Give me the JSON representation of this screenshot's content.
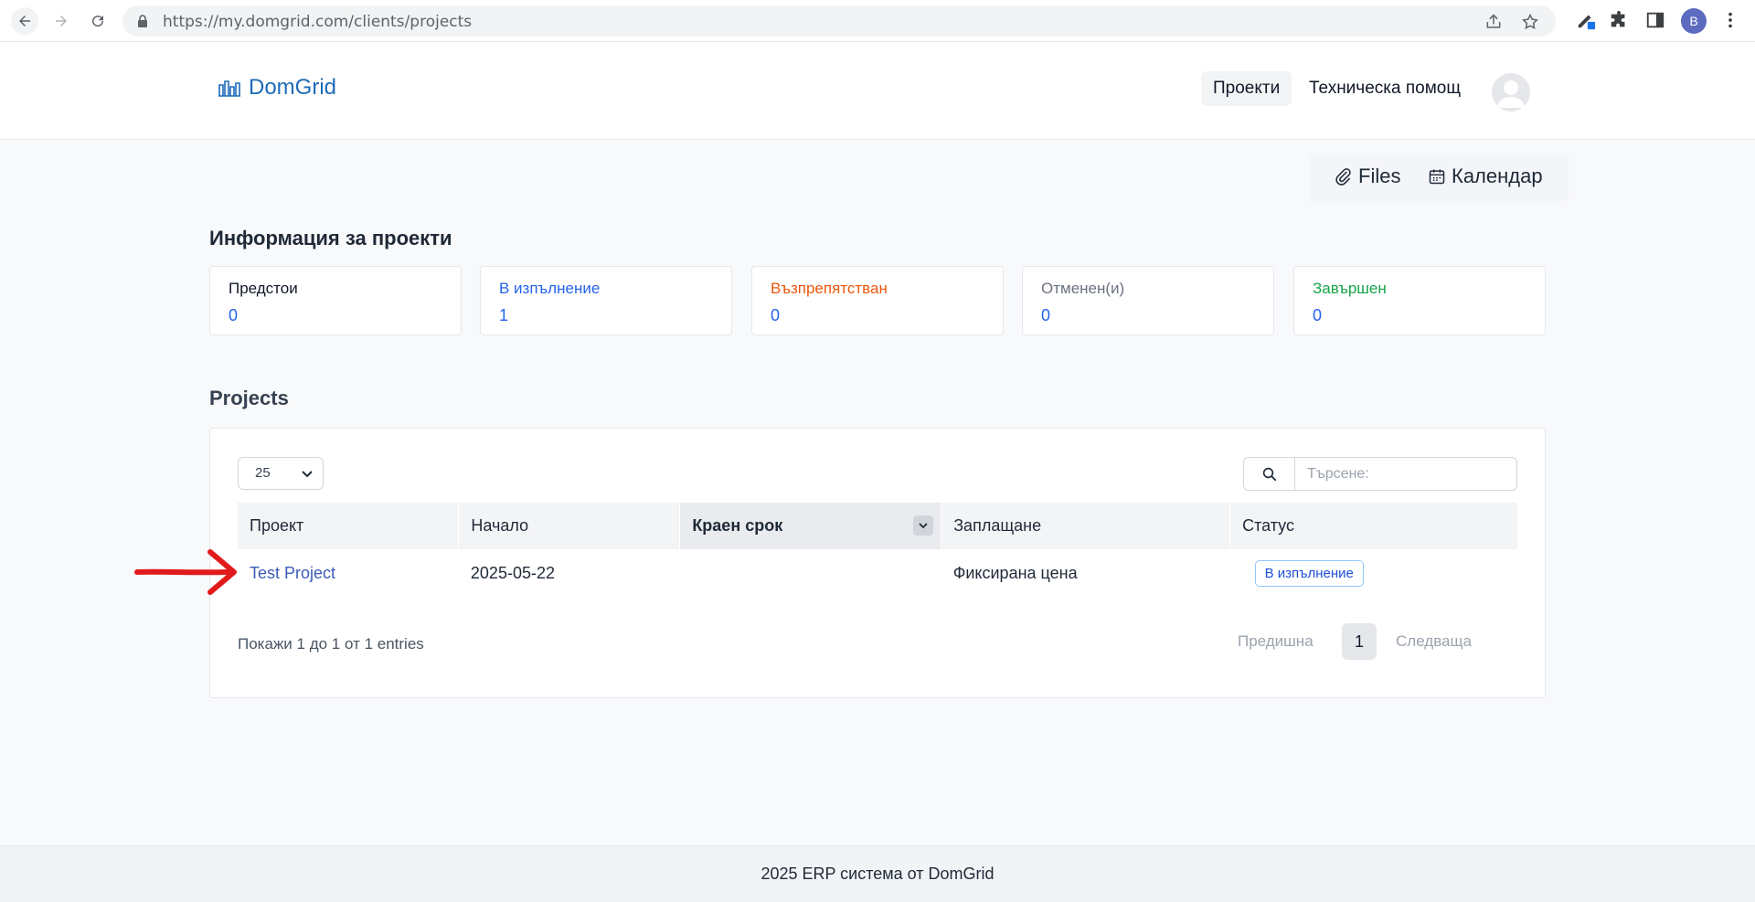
{
  "browser": {
    "url": "https://my.domgrid.com/clients/projects",
    "profile_initial": "B"
  },
  "header": {
    "logo_text": "DomGrid",
    "nav": {
      "projects": "Проекти",
      "help": "Техническа помощ"
    }
  },
  "quick_links": {
    "files": "Files",
    "calendar": "Календар"
  },
  "info_title": "Информация за проекти",
  "stats": [
    {
      "label": "Предстои",
      "value": "0",
      "color": "#111827"
    },
    {
      "label": "В изпълнение",
      "value": "1",
      "color": "#2563eb"
    },
    {
      "label": "Възпрепятстван",
      "value": "0",
      "color": "#ea580c"
    },
    {
      "label": "Отменен(и)",
      "value": "0",
      "color": "#6b7280"
    },
    {
      "label": "Завършен",
      "value": "0",
      "color": "#16a34a"
    }
  ],
  "projects_title": "Projects",
  "table": {
    "length": "25",
    "search_placeholder": "Търсене:",
    "columns": [
      "Проект",
      "Начало",
      "Краен срок",
      "Заплащане",
      "Статус"
    ],
    "rows": [
      {
        "project": "Test Project",
        "start": "2025-05-22",
        "deadline": "",
        "billing": "Фиксирана цена",
        "status": "В изпълнение"
      }
    ],
    "info": "Покажи 1 до 1 от 1 entries",
    "pager": {
      "prev": "Предишна",
      "page": "1",
      "next": "Следваща"
    }
  },
  "footer": "2025 ERP система от DomGrid"
}
